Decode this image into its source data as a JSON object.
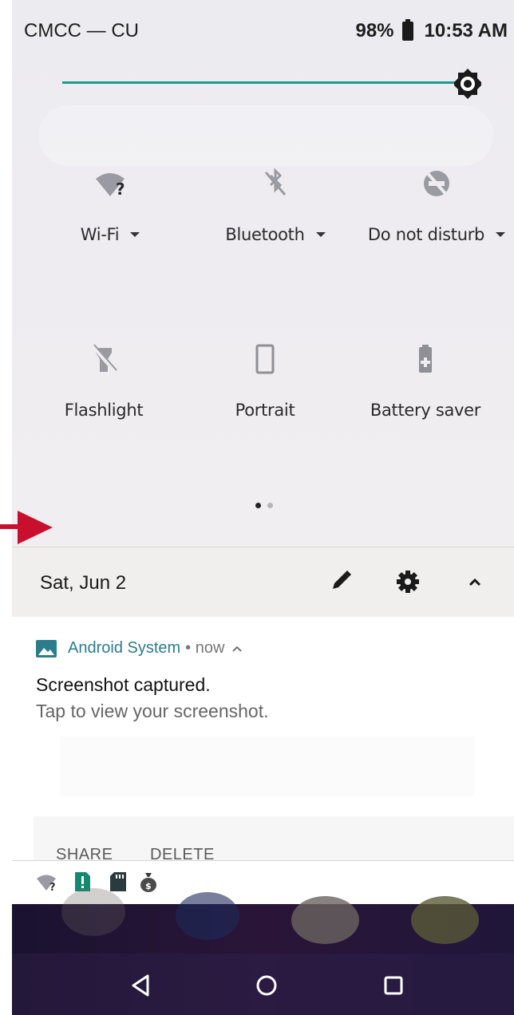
{
  "status_bar": {
    "carrier": "CMCC — CU",
    "battery_percent": "98%",
    "time": "10:53 AM"
  },
  "brightness": {
    "level": 0.89,
    "accent_color": "#199b8e",
    "icon": "brightness-icon"
  },
  "quick_settings": {
    "tiles": [
      {
        "label": "Wi-Fi",
        "icon": "wifi-unknown-icon",
        "expandable": true
      },
      {
        "label": "Bluetooth",
        "icon": "bluetooth-off-icon",
        "expandable": true
      },
      {
        "label": "Do not disturb",
        "icon": "do-not-disturb-off-icon",
        "expandable": true
      },
      {
        "label": "Flashlight",
        "icon": "flashlight-off-icon",
        "expandable": false
      },
      {
        "label": "Portrait",
        "icon": "portrait-lock-icon",
        "expandable": false
      },
      {
        "label": "Battery saver",
        "icon": "battery-saver-icon",
        "expandable": false
      }
    ],
    "page_index": 1,
    "page_count": 2
  },
  "date_row": {
    "date": "Sat, Jun 2",
    "icons": [
      "edit-icon",
      "settings-icon",
      "collapse-icon"
    ]
  },
  "notification": {
    "app_name": "Android System",
    "meta": "• now",
    "title": "Screenshot captured.",
    "subtitle": "Tap to view your screenshot.",
    "actions": {
      "share": "SHARE",
      "delete": "DELETE"
    }
  },
  "mini_status_icons": [
    "wifi-unknown-icon",
    "sim-alert-icon",
    "sd-card-icon",
    "money-bag-icon"
  ],
  "nav_bar": {
    "buttons": [
      "back-icon",
      "home-icon",
      "recents-icon"
    ]
  },
  "annotation": {
    "arrow_color": "#c8102e"
  }
}
